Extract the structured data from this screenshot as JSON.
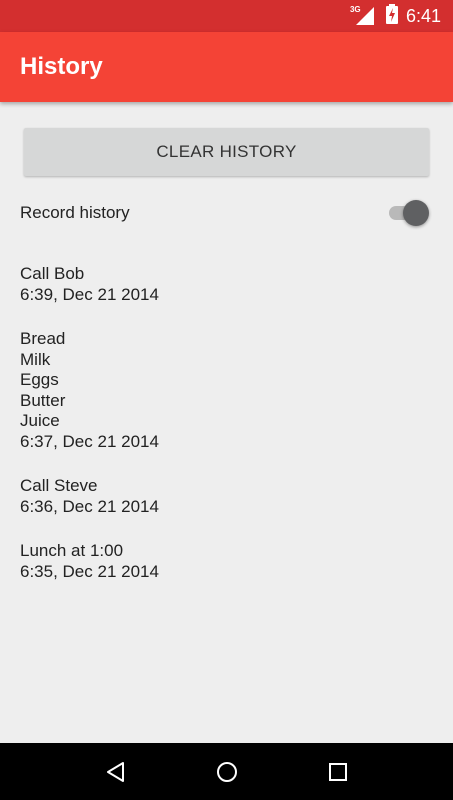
{
  "status_bar": {
    "network_label": "3G",
    "time": "6:41",
    "icons": [
      "cell-signal-icon",
      "battery-charging-icon"
    ]
  },
  "app_bar": {
    "title": "History"
  },
  "clear_button": {
    "label": "CLEAR HISTORY"
  },
  "record_history": {
    "label": "Record history",
    "enabled": true
  },
  "history": [
    {
      "lines": [
        "Call Bob"
      ],
      "timestamp": "6:39, Dec 21 2014"
    },
    {
      "lines": [
        "Bread",
        "Milk",
        "Eggs",
        "Butter",
        "Juice"
      ],
      "timestamp": "6:37, Dec 21 2014"
    },
    {
      "lines": [
        "Call Steve"
      ],
      "timestamp": "6:36, Dec 21 2014"
    },
    {
      "lines": [
        "Lunch at 1:00"
      ],
      "timestamp": "6:35, Dec 21 2014"
    }
  ],
  "nav_bar": {
    "icons": [
      "back-icon",
      "home-icon",
      "recents-icon"
    ]
  },
  "colors": {
    "status_bar": "#d32f2f",
    "app_bar": "#f44336",
    "background": "#eeeeee",
    "button": "#d6d7d7",
    "switch_thumb": "#5f6062"
  }
}
